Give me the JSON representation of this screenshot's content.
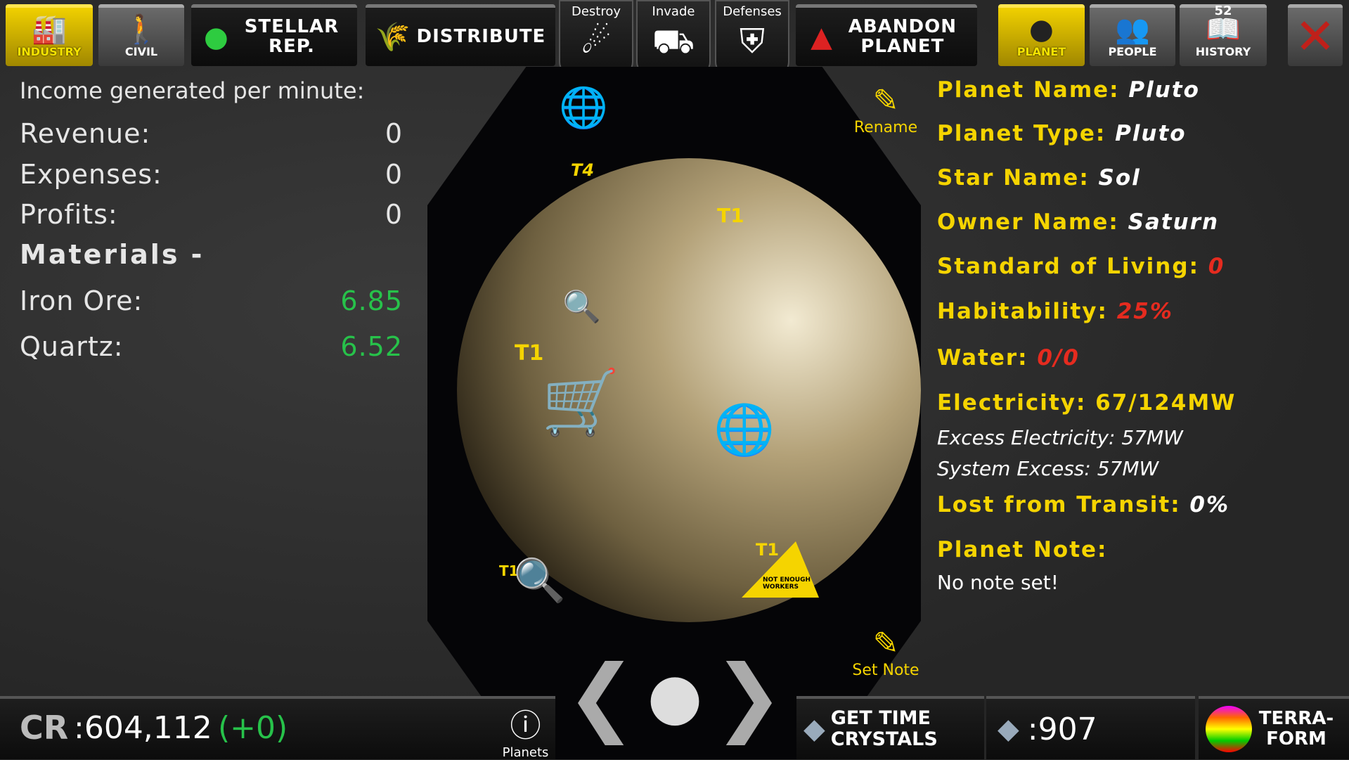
{
  "toolbar": {
    "industry": "INDUSTRY",
    "civil": "CIVIL",
    "stellar": "STELLAR REP.",
    "distribute": "DISTRIBUTE",
    "destroy": "Destroy",
    "invade": "Invade",
    "defenses": "Defenses",
    "abandon": "ABANDON PLANET",
    "planet": "PLANET",
    "people": "PEOPLE",
    "history": "HISTORY",
    "history_badge": "52"
  },
  "income": {
    "title": "Income generated per minute:",
    "rows": [
      {
        "label": "Revenue:",
        "value": "0"
      },
      {
        "label": "Expenses:",
        "value": "0"
      },
      {
        "label": "Profits:",
        "value": "0"
      }
    ],
    "materials_label": "Materials -",
    "materials": [
      {
        "label": "Iron Ore:",
        "value": "6.85"
      },
      {
        "label": "Quartz:",
        "value": "6.52"
      }
    ]
  },
  "map": {
    "labels": [
      "T4",
      "T1",
      "T1",
      "T1",
      "T1"
    ],
    "warning": "NOT ENOUGH WORKERS"
  },
  "info": {
    "rename": "Rename",
    "set_note": "Set Note",
    "planet_name_label": "Planet Name:",
    "planet_name": "Pluto",
    "planet_type_label": "Planet Type:",
    "planet_type": "Pluto",
    "star_label": "Star Name:",
    "star": "Sol",
    "owner_label": "Owner Name:",
    "owner": "Saturn",
    "sol_label": "Standard of Living:",
    "sol": "0",
    "hab_label": "Habitability:",
    "hab": "25%",
    "water_label": "Water:",
    "water": "0/0",
    "elec": "Electricity: 67/124MW",
    "excess": "Excess Electricity: 57MW",
    "system_excess": "System Excess: 57MW",
    "lost_label": "Lost from Transit:",
    "lost": "0%",
    "note_label": "Planet Note:",
    "note": "No note set!"
  },
  "bottom": {
    "credits": ":604,112",
    "credits_delta": "(+0)",
    "planets": "Planets",
    "get_crystals": "GET TIME CRYSTALS",
    "crystals": ":907",
    "terraform": "TERRA- FORM"
  },
  "colors": {
    "accent": "#f5d400",
    "positive": "#27c24a",
    "negative": "#e52b1f"
  }
}
